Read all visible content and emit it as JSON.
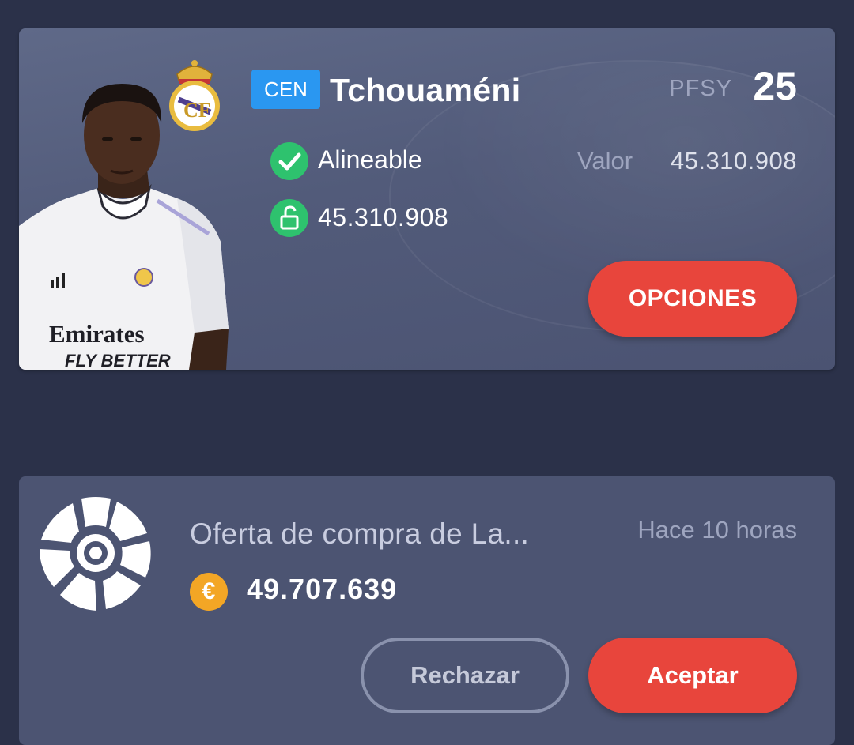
{
  "player": {
    "position": "CEN",
    "name": "Tchouaméni",
    "pfsy_label": "PFSY",
    "pfsy_value": "25",
    "status": "Alineable",
    "clause": "45.310.908",
    "valor_label": "Valor",
    "valor_value": "45.310.908",
    "options_label": "OPCIONES",
    "jersey_sponsor_line1": "Emirates",
    "jersey_sponsor_line2": "FLY BETTER"
  },
  "offer": {
    "title": "Oferta de compra de La...",
    "time": "Hace 10 horas",
    "currency_symbol": "€",
    "amount": "49.707.639",
    "reject_label": "Rechazar",
    "accept_label": "Aceptar"
  },
  "icons": {
    "status": "check-circle-icon",
    "clause": "unlock-icon",
    "currency": "euro-coin-icon",
    "club": "real-madrid-crest-icon",
    "league": "laliga-logo-icon"
  },
  "colors": {
    "background": "#2b3149",
    "card": "#525b7a",
    "accent_red": "#e8453c",
    "position_blue": "#2a97f1",
    "status_green": "#2ec26e",
    "coin_orange": "#f3a625"
  }
}
